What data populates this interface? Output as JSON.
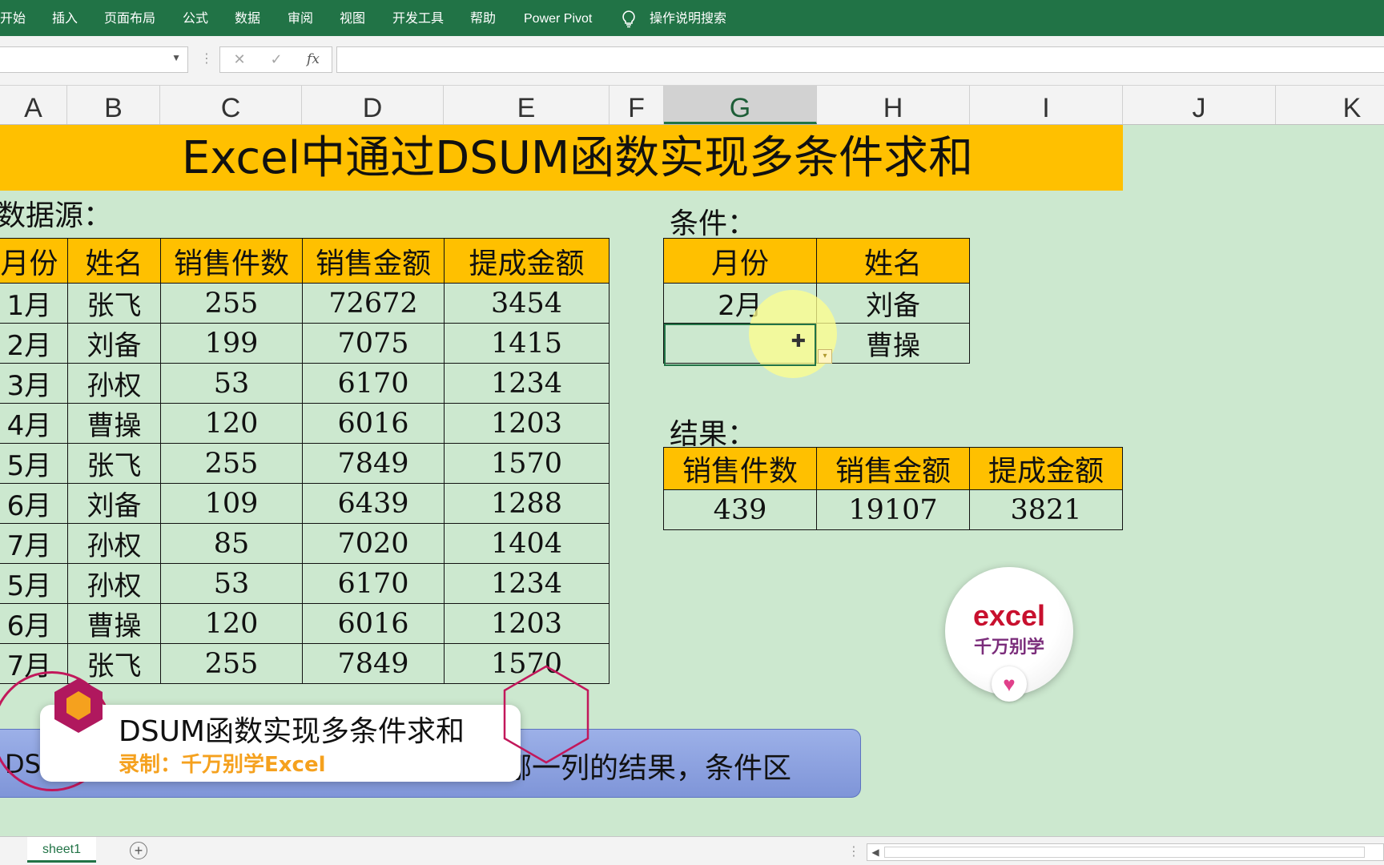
{
  "ribbon": {
    "menu": [
      "开始",
      "插入",
      "页面布局",
      "公式",
      "数据",
      "审阅",
      "视图",
      "开发工具",
      "帮助",
      "Power Pivot"
    ],
    "search_label": "操作说明搜索"
  },
  "formula_bar": {
    "cancel": "✕",
    "enter": "✓",
    "fx": "fx",
    "name_box": "",
    "formula": ""
  },
  "columns": [
    "A",
    "B",
    "C",
    "D",
    "E",
    "F",
    "G",
    "H",
    "I",
    "J",
    "K"
  ],
  "selected_column": "G",
  "title": "Excel中通过DSUM函数实现多条件求和",
  "source": {
    "label": "数据源：",
    "headers": [
      "月份",
      "姓名",
      "销售件数",
      "销售金额",
      "提成金额"
    ],
    "rows": [
      [
        "1月",
        "张飞",
        "255",
        "72672",
        "3454"
      ],
      [
        "2月",
        "刘备",
        "199",
        "7075",
        "1415"
      ],
      [
        "3月",
        "孙权",
        "53",
        "6170",
        "1234"
      ],
      [
        "4月",
        "曹操",
        "120",
        "6016",
        "1203"
      ],
      [
        "5月",
        "张飞",
        "255",
        "7849",
        "1570"
      ],
      [
        "6月",
        "刘备",
        "109",
        "6439",
        "1288"
      ],
      [
        "7月",
        "孙权",
        "85",
        "7020",
        "1404"
      ],
      [
        "5月",
        "孙权",
        "53",
        "6170",
        "1234"
      ],
      [
        "6月",
        "曹操",
        "120",
        "6016",
        "1203"
      ],
      [
        "7月",
        "张飞",
        "255",
        "7849",
        "1570"
      ]
    ]
  },
  "condition": {
    "label": "条件：",
    "headers": [
      "月份",
      "姓名"
    ],
    "rows": [
      [
        "2月",
        "刘备"
      ],
      [
        "",
        "曹操"
      ]
    ]
  },
  "result": {
    "label": "结果：",
    "headers": [
      "销售件数",
      "销售金额",
      "提成金额"
    ],
    "values": [
      "439",
      "19107",
      "3821"
    ]
  },
  "logo": {
    "line1": "excel",
    "line2": "千万别学"
  },
  "caption": {
    "left": "DS",
    "right": "哪一列的结果，条件区",
    "banner_title": "DSUM函数实现多条件求和",
    "banner_sub": "录制：千万别学Excel"
  },
  "sheet_tab": "sheet1",
  "colors": {
    "ribbon": "#217346",
    "header_fill": "#ffc000",
    "sheet_bg": "#cce8cf",
    "caption_bar": "#8fa3e0"
  }
}
